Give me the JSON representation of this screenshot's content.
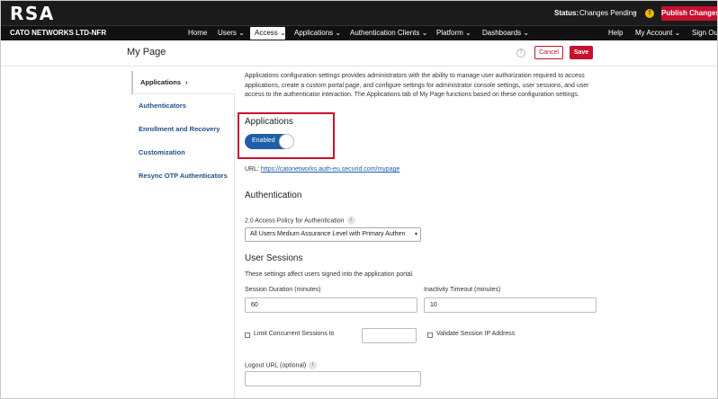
{
  "brand": {
    "logo": "RSA"
  },
  "topbar": {
    "status_label": "Status:",
    "status_value": "Changes Pending",
    "status_chevron": "⌄",
    "warning_icon": "!",
    "publish_label": "Publish Changes"
  },
  "nav": {
    "org": "CATO NETWORKS LTD-NFR",
    "items": [
      {
        "label": "Home"
      },
      {
        "label": "Users ⌄"
      },
      {
        "label": "Access ⌄"
      },
      {
        "label": "Applications ⌄"
      },
      {
        "label": "Authentication Clients ⌄"
      },
      {
        "label": "Platform ⌄"
      },
      {
        "label": "Dashboards ⌄"
      },
      {
        "label": "Help"
      },
      {
        "label": "My Account ⌄"
      },
      {
        "label": "Sign Out"
      }
    ]
  },
  "header": {
    "title": "My Page",
    "help_icon": "?",
    "cancel_label": "Cancel",
    "save_label": "Save"
  },
  "sidebar": {
    "items": [
      {
        "label": "Applications",
        "chevron": "›"
      },
      {
        "label": "Authenticators"
      },
      {
        "label": "Enrollment and Recovery"
      },
      {
        "label": "Customization"
      },
      {
        "label": "Resync OTP Authenticators"
      }
    ]
  },
  "main": {
    "intro": "Applications configuration settings provides administrators with the ability to manage user authorization required to access applications, create a custom portal page, and configure settings for administrator console settings, user sessions, and user access to the authenticator interaction. The Applications tab of My Page functions based on these configuration settings.",
    "applications": {
      "heading": "Applications",
      "toggle_label": "Enabled",
      "url_label": "URL:",
      "url": "https://catonetworks.auth-eu.securid.com/mypage"
    },
    "authentication": {
      "heading": "Authentication",
      "policy_label": "2.0 Access Policy for Authentication",
      "info_icon": "i",
      "policy_value": "All Users Medium Assurance Level with Primary Authen",
      "select_arrow": "▾"
    },
    "sessions": {
      "heading": "User Sessions",
      "description": "These settings affect users signed into the application portal.",
      "duration_label": "Session Duration (minutes)",
      "duration_value": "60",
      "inactivity_label": "Inactivity Timeout (minutes)",
      "inactivity_value": "10",
      "limit_label": "Limit Concurrent Sessions to",
      "limit_value": "",
      "validate_label": "Validate Session IP Address",
      "logout_label": "Logout URL (optional)",
      "logout_value": ""
    }
  }
}
